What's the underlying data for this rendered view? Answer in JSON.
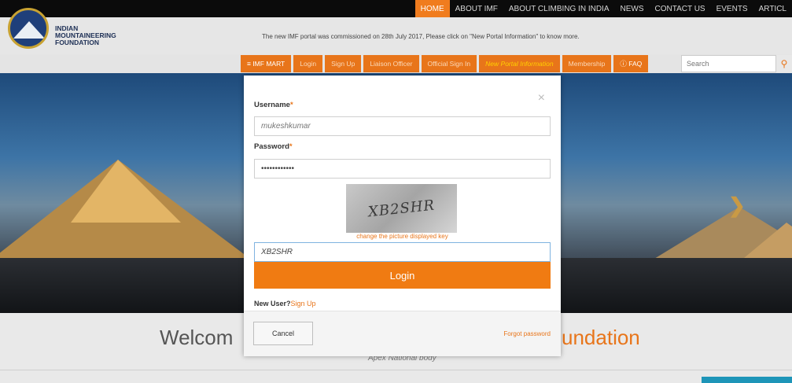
{
  "topnav": {
    "items": [
      {
        "label": "HOME",
        "active": true
      },
      {
        "label": "ABOUT IMF"
      },
      {
        "label": "ABOUT CLIMBING IN INDIA"
      },
      {
        "label": "NEWS"
      },
      {
        "label": "CONTACT US"
      },
      {
        "label": "EVENTS"
      },
      {
        "label": "ARTICL"
      }
    ]
  },
  "header": {
    "brand_line1": "INDIAN",
    "brand_line2": "MOUNTAINEERING",
    "brand_line3": "FOUNDATION",
    "notice": "The new IMF portal was commissioned on 28th July 2017, Please click on \"New Portal Information\" to know more."
  },
  "menu": {
    "imf_mart": "≡ IMF MART",
    "login": "Login",
    "signup": "Sign Up",
    "liaison": "Liaison Officer",
    "official": "Official Sign In",
    "portal_info": "New Portal Information",
    "membership": "Membership",
    "faq": "ⓘ FAQ",
    "search_placeholder": "Search"
  },
  "welcome": {
    "left": "Welcom",
    "right": "undation",
    "tagline": "Apex National body"
  },
  "modal": {
    "username_label": "Username",
    "required_mark": "*",
    "username_value": "mukeshkumar",
    "password_label": "Password",
    "password_value": "••••••••••••",
    "captcha_image_text": "XB2SHR",
    "captcha_link": "change the picture displayed key",
    "captcha_value": "XB2SHR",
    "login_button": "Login",
    "new_user_text": "New User?",
    "signup_link": "Sign Up",
    "cancel_button": "Cancel",
    "forgot_link": "Forgot password",
    "close_glyph": "×"
  },
  "colors": {
    "accent": "#f07b12",
    "nav_bg": "#0b0b0b",
    "brand_navy": "#1d2f55"
  },
  "icons": {
    "search": "search-icon",
    "close": "close-icon",
    "next": "chevron-right-icon"
  }
}
